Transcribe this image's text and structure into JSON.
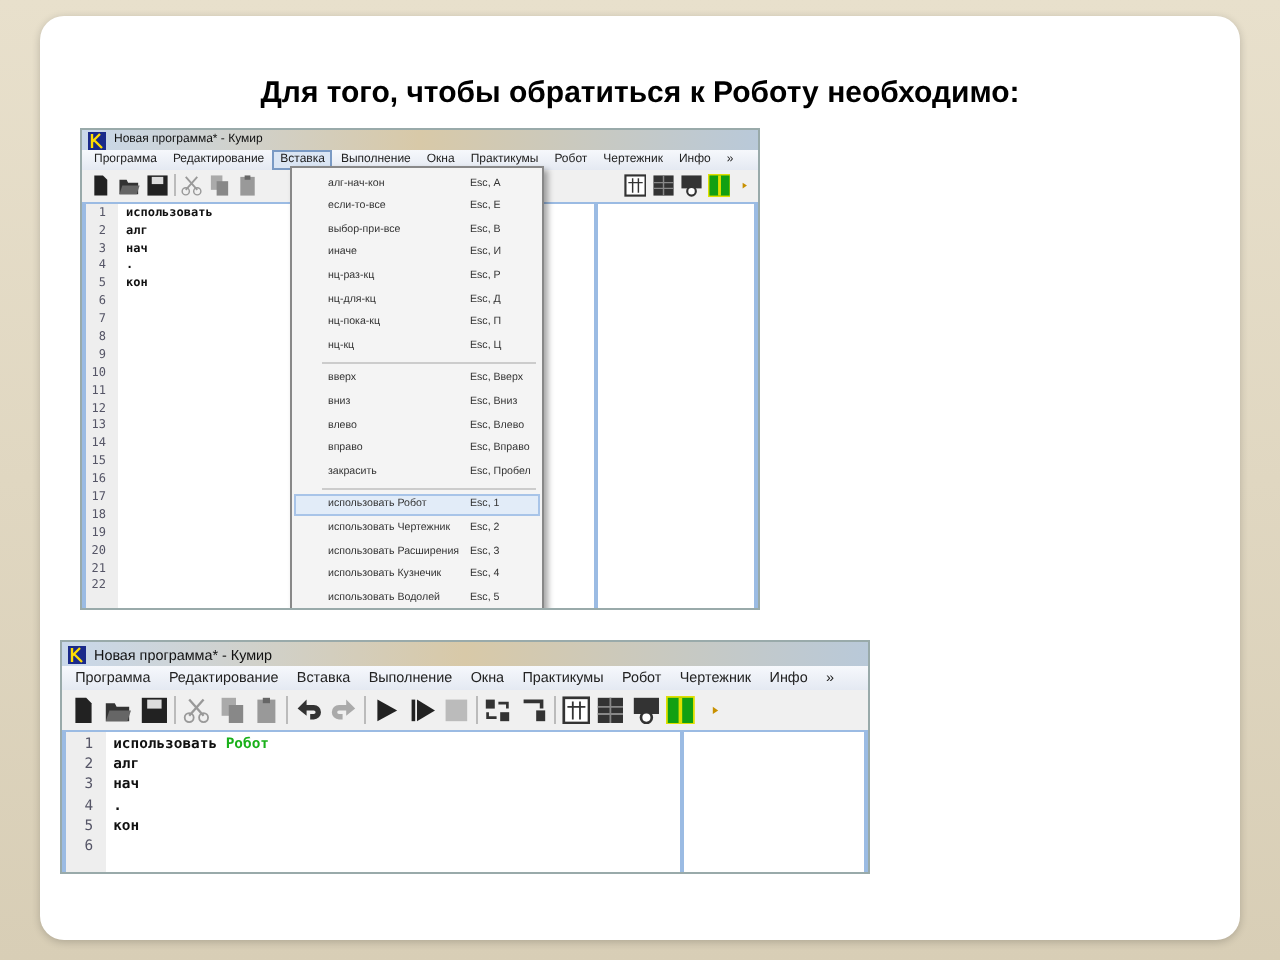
{
  "slide": {
    "title": "Для того, чтобы обратиться к Роботу необходимо:"
  },
  "screenshots": [
    {
      "title_bar": "Новая программа* - Кумир",
      "menu": [
        {
          "label": "Программа",
          "selected": false
        },
        {
          "label": "Редактирование",
          "selected": false
        },
        {
          "label": "Вставка",
          "selected": true
        },
        {
          "label": "Выполнение",
          "selected": false
        },
        {
          "label": "Окна",
          "selected": false
        },
        {
          "label": "Практикумы",
          "selected": false
        },
        {
          "label": "Робот",
          "selected": false
        },
        {
          "label": "Чертежник",
          "selected": false
        },
        {
          "label": "Инфо",
          "selected": false
        },
        {
          "label": "»",
          "selected": false
        }
      ],
      "line_numbers": [
        "1",
        "2",
        "3",
        "4",
        "5",
        "6",
        "7",
        "8",
        "9",
        "10",
        "11",
        "12",
        "13",
        "14",
        "15",
        "16",
        "17",
        "18",
        "19",
        "20",
        "21",
        "22"
      ],
      "code_lines": [
        [
          {
            "text": "использовать",
            "kind": "keyword"
          }
        ],
        [
          {
            "text": "алг",
            "kind": "keyword"
          }
        ],
        [
          {
            "text": "нач",
            "kind": "keyword"
          }
        ],
        [
          {
            "text": ".",
            "kind": "keyword"
          }
        ],
        [
          {
            "text": "кон",
            "kind": "keyword"
          }
        ]
      ],
      "dropdown": {
        "groups": [
          [
            {
              "label": "алг-нач-кон",
              "shortcut": "Esc, А",
              "selected": false
            },
            {
              "label": "если-то-все",
              "shortcut": "Esc, Е",
              "selected": false
            },
            {
              "label": "выбор-при-все",
              "shortcut": "Esc, В",
              "selected": false
            },
            {
              "label": "иначе",
              "shortcut": "Esc, И",
              "selected": false
            },
            {
              "label": "нц-раз-кц",
              "shortcut": "Esc, Р",
              "selected": false
            },
            {
              "label": "нц-для-кц",
              "shortcut": "Esc, Д",
              "selected": false
            },
            {
              "label": "нц-пока-кц",
              "shortcut": "Esc, П",
              "selected": false
            },
            {
              "label": "нц-кц",
              "shortcut": "Esc, Ц",
              "selected": false
            }
          ],
          [
            {
              "label": "вверх",
              "shortcut": "Esc, Вверх",
              "selected": false
            },
            {
              "label": "вниз",
              "shortcut": "Esc, Вниз",
              "selected": false
            },
            {
              "label": "влево",
              "shortcut": "Esc, Влево",
              "selected": false
            },
            {
              "label": "вправо",
              "shortcut": "Esc, Вправо",
              "selected": false
            },
            {
              "label": "закрасить",
              "shortcut": "Esc, Пробел",
              "selected": false
            }
          ],
          [
            {
              "label": "использовать Робот",
              "shortcut": "Esc, 1",
              "selected": true
            },
            {
              "label": "использовать Чертежник",
              "shortcut": "Esc, 2",
              "selected": false
            },
            {
              "label": "использовать Расширения",
              "shortcut": "Esc, 3",
              "selected": false
            },
            {
              "label": "использовать Кузнечик",
              "shortcut": "Esc, 4",
              "selected": false
            },
            {
              "label": "использовать Водолей",
              "shortcut": "Esc, 5",
              "selected": false
            }
          ]
        ]
      }
    },
    {
      "title_bar": "Новая программа* - Кумир",
      "menu": [
        {
          "label": "Программа",
          "selected": false
        },
        {
          "label": "Редактирование",
          "selected": false
        },
        {
          "label": "Вставка",
          "selected": false
        },
        {
          "label": "Выполнение",
          "selected": false
        },
        {
          "label": "Окна",
          "selected": false
        },
        {
          "label": "Практикумы",
          "selected": false
        },
        {
          "label": "Робот",
          "selected": false
        },
        {
          "label": "Чертежник",
          "selected": false
        },
        {
          "label": "Инфо",
          "selected": false
        },
        {
          "label": "»",
          "selected": false
        }
      ],
      "line_numbers": [
        "1",
        "2",
        "3",
        "4",
        "5",
        "6"
      ],
      "code_lines": [
        [
          {
            "text": "использовать",
            "kind": "keyword"
          },
          {
            "text": "Робот",
            "kind": "name"
          }
        ],
        [
          {
            "text": "алг",
            "kind": "keyword"
          }
        ],
        [
          {
            "text": "нач",
            "kind": "keyword"
          }
        ],
        [
          {
            "text": ".",
            "kind": "keyword"
          }
        ],
        [
          {
            "text": "кон",
            "kind": "keyword"
          }
        ]
      ]
    }
  ]
}
